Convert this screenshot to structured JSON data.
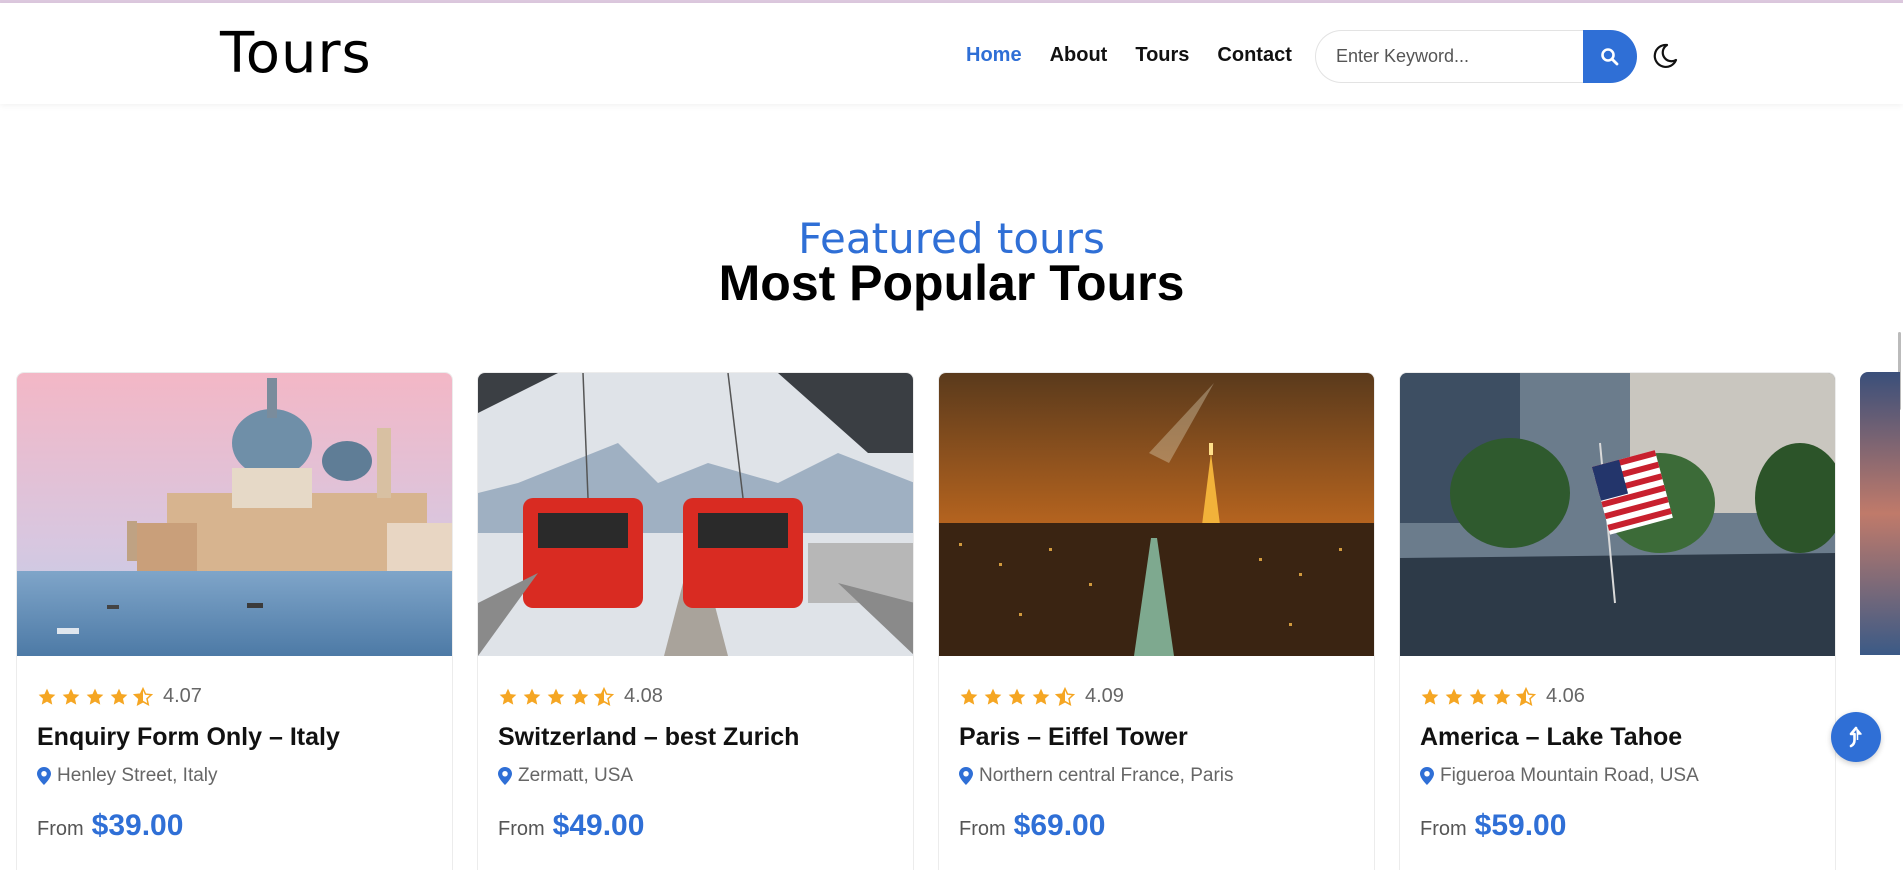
{
  "header": {
    "logo": "Tours",
    "nav": [
      {
        "label": "Home",
        "active": true
      },
      {
        "label": "About",
        "active": false
      },
      {
        "label": "Tours",
        "active": false
      },
      {
        "label": "Contact",
        "active": false
      }
    ],
    "search": {
      "placeholder": "Enter Keyword...",
      "value": "",
      "button_icon": "search-icon"
    },
    "theme_icon": "moon-icon"
  },
  "section": {
    "subtitle": "Featured tours",
    "title": "Most Popular Tours"
  },
  "tours": [
    {
      "rating": "4.07",
      "title": "Enquiry Form Only – Italy",
      "location": "Henley Street, Italy",
      "price_prefix": "From",
      "price": "$39.00"
    },
    {
      "rating": "4.08",
      "title": "Switzerland – best Zurich",
      "location": "Zermatt, USA",
      "price_prefix": "From",
      "price": "$49.00"
    },
    {
      "rating": "4.09",
      "title": "Paris – Eiffel Tower",
      "location": "Northern central France, Paris",
      "price_prefix": "From",
      "price": "$69.00"
    },
    {
      "rating": "4.06",
      "title": "America – Lake Tahoe",
      "location": "Figueroa Mountain Road, USA",
      "price_prefix": "From",
      "price": "$59.00"
    }
  ],
  "star_rating_display": 4.5,
  "colors": {
    "accent": "#2f6fd6",
    "star": "#f5a623",
    "text": "#111111",
    "muted": "#666666"
  },
  "back_to_top_icon": "arrow-up-icon"
}
